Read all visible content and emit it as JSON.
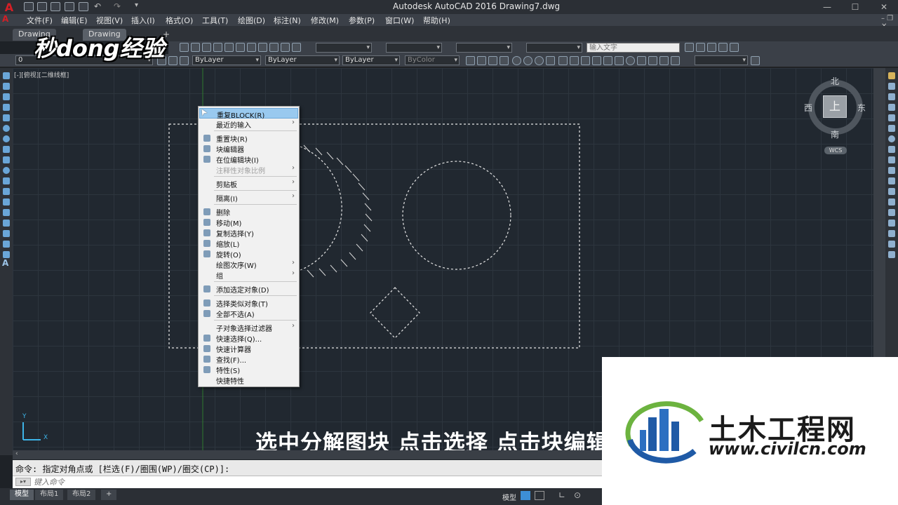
{
  "app": {
    "title": "Autodesk AutoCAD 2016    Drawing7.dwg",
    "logo_letter": "A"
  },
  "menu": [
    "文件(F)",
    "编辑(E)",
    "视图(V)",
    "插入(I)",
    "格式(O)",
    "工具(T)",
    "绘图(D)",
    "标注(N)",
    "修改(M)",
    "参数(P)",
    "窗口(W)",
    "帮助(H)"
  ],
  "tabs": [
    "Drawing",
    "Drawing"
  ],
  "toolbar": {
    "layer_value": "0",
    "color_value": "ByLayer",
    "linetype_value": "ByLayer",
    "lineweight_value": "ByLayer",
    "plotstyle_value": "ByColor",
    "search_placeholder": "输入文字"
  },
  "viewport": {
    "label": "[-][俯视][二维线框]"
  },
  "viewcube": {
    "north": "北",
    "south": "南",
    "east": "东",
    "west": "西",
    "face": "上",
    "wcs": "WCS"
  },
  "ucs": {
    "x": "X",
    "y": "Y"
  },
  "context_menu": [
    {
      "label": "重复BLOCK(R)",
      "highlight": true
    },
    {
      "label": "最近的输入",
      "submenu": true
    },
    {
      "sep": true
    },
    {
      "label": "重置块(R)",
      "icon": true
    },
    {
      "label": "块编辑器",
      "icon": true
    },
    {
      "label": "在位编辑块(I)",
      "icon": true
    },
    {
      "label": "注释性对象比例",
      "submenu": true,
      "disabled": true
    },
    {
      "sep": true
    },
    {
      "label": "剪贴板",
      "submenu": true
    },
    {
      "sep": true
    },
    {
      "label": "隔离(I)",
      "submenu": true
    },
    {
      "sep": true
    },
    {
      "label": "删除",
      "icon": true
    },
    {
      "label": "移动(M)",
      "icon": true
    },
    {
      "label": "复制选择(Y)",
      "icon": true
    },
    {
      "label": "缩放(L)",
      "icon": true
    },
    {
      "label": "旋转(O)",
      "icon": true
    },
    {
      "label": "绘图次序(W)",
      "submenu": true
    },
    {
      "label": "组",
      "submenu": true
    },
    {
      "sep": true
    },
    {
      "label": "添加选定对象(D)",
      "icon": true
    },
    {
      "sep": true
    },
    {
      "label": "选择类似对象(T)",
      "icon": true
    },
    {
      "label": "全部不选(A)",
      "icon": true
    },
    {
      "sep": true
    },
    {
      "label": "子对象选择过滤器",
      "submenu": true
    },
    {
      "label": "快速选择(Q)...",
      "icon": true
    },
    {
      "label": "快速计算器",
      "icon": true
    },
    {
      "label": "查找(F)...",
      "icon": true
    },
    {
      "label": "特性(S)",
      "icon": true
    },
    {
      "label": "快捷特性"
    }
  ],
  "subtitle": "选中分解图块 点击选择 点击块编辑",
  "watermark": {
    "logo_text": "秒dong经验",
    "brand": "土木工程网",
    "url": "www.civilcn.com"
  },
  "command": {
    "history": "命令: 指定对角点或 [栏选(F)/圈围(WP)/圈交(CP)]:",
    "placeholder": "键入命令"
  },
  "layout_tabs": [
    "模型",
    "布局1",
    "布局2",
    "+"
  ],
  "status": {
    "model_label": "模型"
  },
  "colors": {
    "accent": "#99c9ef",
    "canvas": "#212830",
    "logo_red": "#d31f26"
  }
}
